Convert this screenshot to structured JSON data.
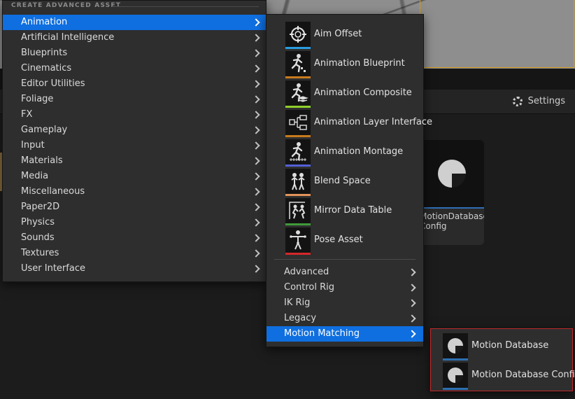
{
  "editor": {
    "settings_label": "Settings",
    "settings_icon": "gear-icon",
    "asset_tile_name": "MotionDatabase\nConfig"
  },
  "menu_main": {
    "header": "CREATE ADVANCED ASSET",
    "items": [
      {
        "label": "Animation",
        "active": true
      },
      {
        "label": "Artificial Intelligence"
      },
      {
        "label": "Blueprints"
      },
      {
        "label": "Cinematics"
      },
      {
        "label": "Editor Utilities"
      },
      {
        "label": "Foliage"
      },
      {
        "label": "FX"
      },
      {
        "label": "Gameplay"
      },
      {
        "label": "Input"
      },
      {
        "label": "Materials"
      },
      {
        "label": "Media"
      },
      {
        "label": "Miscellaneous"
      },
      {
        "label": "Paper2D"
      },
      {
        "label": "Physics"
      },
      {
        "label": "Sounds"
      },
      {
        "label": "Textures"
      },
      {
        "label": "User Interface"
      }
    ]
  },
  "menu_animation": {
    "assets": [
      {
        "label": "Aim Offset",
        "icon": "aim-offset-icon",
        "color": "#2a9be0"
      },
      {
        "label": "Animation Blueprint",
        "icon": "animation-blueprint-icon",
        "color": "#c87a1e"
      },
      {
        "label": "Animation Composite",
        "icon": "animation-composite-icon",
        "color": "#8fce2a"
      },
      {
        "label": "Animation Layer Interface",
        "icon": "animation-layer-interface-icon",
        "color": "#c87a1e"
      },
      {
        "label": "Animation Montage",
        "icon": "animation-montage-icon",
        "color": "#5560d8"
      },
      {
        "label": "Blend Space",
        "icon": "blend-space-icon",
        "color": "#e0935a"
      },
      {
        "label": "Mirror Data Table",
        "icon": "mirror-data-table-icon",
        "color": "#3f9a3a"
      },
      {
        "label": "Pose Asset",
        "icon": "pose-asset-icon",
        "color": "#d6262a"
      }
    ],
    "submenus": [
      {
        "label": "Advanced"
      },
      {
        "label": "Control Rig"
      },
      {
        "label": "IK Rig"
      },
      {
        "label": "Legacy"
      },
      {
        "label": "Motion Matching",
        "active": true
      }
    ]
  },
  "menu_motion_matching": {
    "assets": [
      {
        "label": "Motion Database",
        "icon": "motion-database-icon"
      },
      {
        "label": "Motion Database Config",
        "icon": "motion-database-config-icon"
      }
    ]
  },
  "colors": {
    "highlight": "#0f6fe0",
    "selection_outline": "#c0282b",
    "viewport_outline": "#d39a1c"
  }
}
